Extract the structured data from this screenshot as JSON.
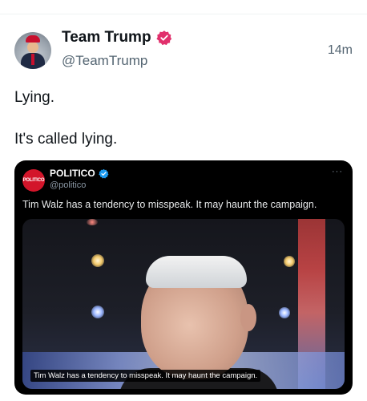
{
  "author": {
    "display_name": "Team Trump",
    "handle": "@TeamTrump",
    "timestamp": "14m",
    "verified_color": "#e1306c"
  },
  "tweet": {
    "lines": [
      "Lying.",
      "It's called lying."
    ]
  },
  "quote": {
    "avatar_text": "POLITICO",
    "display_name": "POLITICO",
    "handle": "@politico",
    "more_label": "···",
    "text": "Tim Walz has a tendency to misspeak. It may haunt the campaign.",
    "media_caption": "Tim Walz has a tendency to misspeak. It may haunt the campaign.",
    "brand_color": "#d3152a",
    "verified_color": "#1d9bf0"
  }
}
